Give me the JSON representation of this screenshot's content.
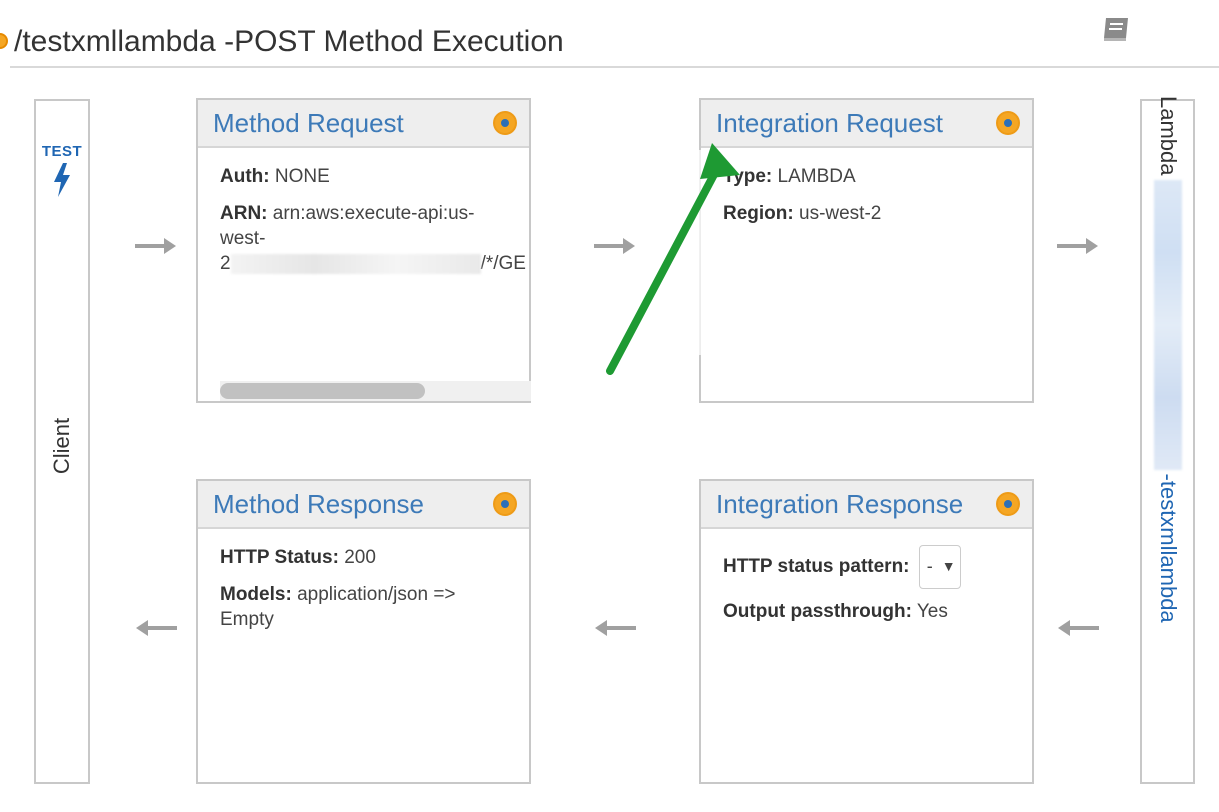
{
  "header": {
    "title": "/testxmllambda -POST Method Execution",
    "docs_icon": "book-icon"
  },
  "client_panel": {
    "test_label": "TEST",
    "test_icon": "lightning-bolt-icon",
    "label": "Client"
  },
  "method_request": {
    "title": "Method Request",
    "auth_label": "Auth:",
    "auth_value": "NONE",
    "arn_label": "ARN:",
    "arn_value_visible_start": "arn:aws:execute-api:us-west-2",
    "arn_value_visible_end": "/*/GE"
  },
  "integration_request": {
    "title": "Integration Request",
    "type_label": "Type:",
    "type_value": "LAMBDA",
    "region_label": "Region:",
    "region_value": "us-west-2"
  },
  "method_response": {
    "title": "Method Response",
    "status_label": "HTTP Status:",
    "status_value": "200",
    "models_label": "Models:",
    "models_value": "application/json => Empty"
  },
  "integration_response": {
    "title": "Integration Response",
    "pattern_label": "HTTP status pattern:",
    "pattern_selected": "-",
    "passthrough_label": "Output passthrough:",
    "passthrough_value": "Yes"
  },
  "lambda_panel": {
    "label": "Lambda",
    "function_name_suffix": "-testxmllambda"
  },
  "colors": {
    "link_blue": "#3d7ab8",
    "status_dot_orange": "#f5a623",
    "annotation_arrow_green": "#1e9a33",
    "flow_arrow_gray": "#a0a0a0"
  }
}
